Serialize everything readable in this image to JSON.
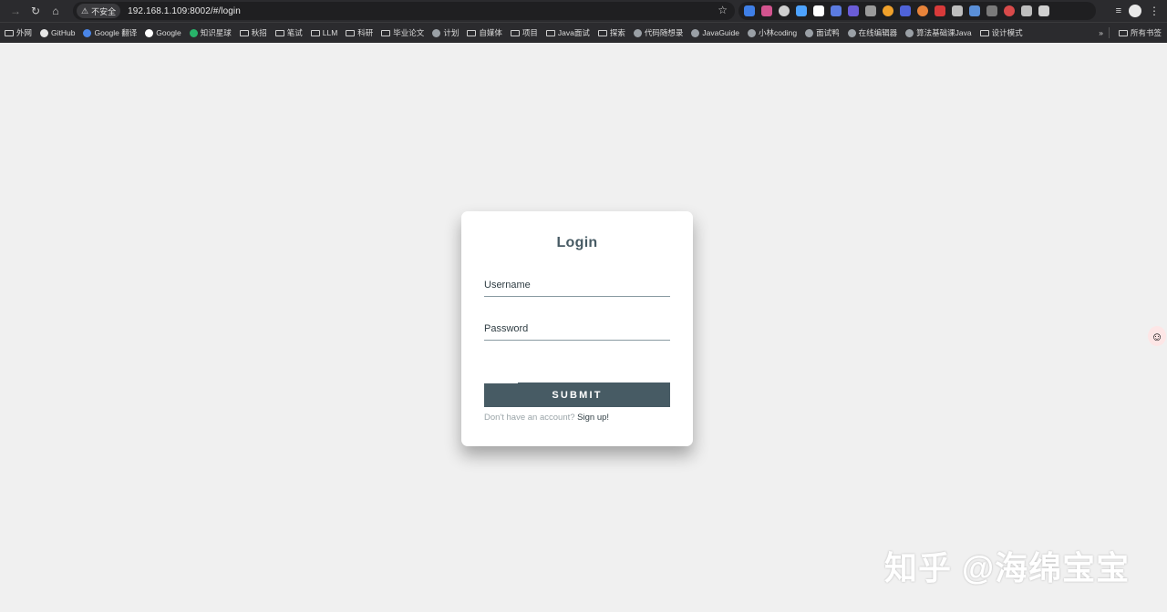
{
  "browser": {
    "nav": {
      "back_icon": "arrow-left-icon",
      "reload_icon": "reload-icon",
      "home_icon": "home-icon"
    },
    "security_label": "不安全",
    "url": "192.168.1.109:8002/#/login"
  },
  "bookmarks": [
    {
      "label": "外网",
      "icon": "folder"
    },
    {
      "label": "GitHub",
      "icon": "github"
    },
    {
      "label": "Google 翻译",
      "icon": "google-translate"
    },
    {
      "label": "Google",
      "icon": "google"
    },
    {
      "label": "知识星球",
      "icon": "planet"
    },
    {
      "label": "秋招",
      "icon": "folder"
    },
    {
      "label": "笔试",
      "icon": "folder"
    },
    {
      "label": "LLM",
      "icon": "folder"
    },
    {
      "label": "科研",
      "icon": "folder"
    },
    {
      "label": "毕业论文",
      "icon": "folder"
    },
    {
      "label": "计划",
      "icon": "site"
    },
    {
      "label": "自媒体",
      "icon": "folder"
    },
    {
      "label": "项目",
      "icon": "folder"
    },
    {
      "label": "Java面试",
      "icon": "folder"
    },
    {
      "label": "探索",
      "icon": "folder"
    },
    {
      "label": "代码随想录",
      "icon": "site"
    },
    {
      "label": "JavaGuide",
      "icon": "site"
    },
    {
      "label": "小林coding",
      "icon": "site"
    },
    {
      "label": "面试鸭",
      "icon": "site"
    },
    {
      "label": "在线编辑器",
      "icon": "site"
    },
    {
      "label": "算法基础课Java",
      "icon": "site"
    },
    {
      "label": "设计模式",
      "icon": "folder"
    }
  ],
  "bookmarks_overflow": "»",
  "bookmarks_all": "所有书签",
  "login": {
    "title": "Login",
    "username_placeholder": "Username",
    "password_placeholder": "Password",
    "submit_label": "SUBMIT",
    "signup_prompt": "Don't have an account?",
    "signup_link": "Sign up!"
  },
  "watermark": "知乎 @海绵宝宝",
  "colors": {
    "accent": "#475b64",
    "page_bg": "#f0f0f0",
    "card_bg": "#ffffff",
    "browser_chrome": "#2b2b2e"
  }
}
